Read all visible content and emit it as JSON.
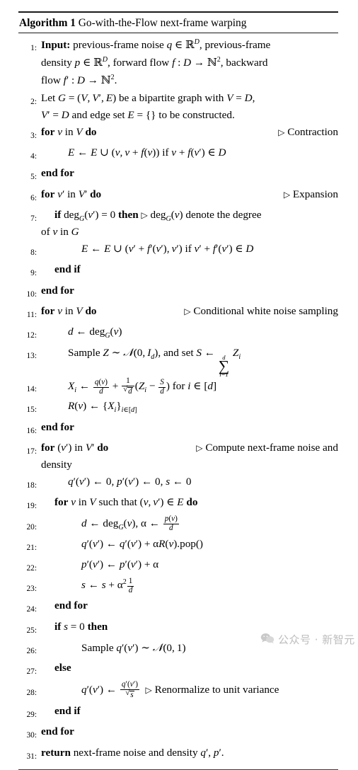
{
  "document": {
    "type": "algorithm-pseudocode-block",
    "title_keyword": "Algorithm 1",
    "title_text": "Go-with-the-Flow next-frame warping"
  },
  "lines": [
    {
      "no": "1:",
      "indent": 0,
      "text": "Input: previous-frame noise q ∈ ℝᴰ, previous-frame density p ∈ ℝᴰ, forward flow f : D → ℕ2, backward flow f′ : D → ℕ2.",
      "comment": ""
    },
    {
      "no": "2:",
      "indent": 0,
      "text": "Let G = (V, V′, E) be a bipartite graph with V = D, V′ = D and edge set E = {} to be constructed.",
      "comment": ""
    },
    {
      "no": "3:",
      "indent": 0,
      "text": "for v in V do",
      "comment": "Contraction"
    },
    {
      "no": "4:",
      "indent": 1,
      "text": "E ← E ∪ (v, v + f(v)) if v + f(v′) ∈ D",
      "comment": ""
    },
    {
      "no": "5:",
      "indent": 0,
      "text": "end for",
      "comment": ""
    },
    {
      "no": "6:",
      "indent": 0,
      "text": "for v′ in V′ do",
      "comment": "Expansion"
    },
    {
      "no": "7:",
      "indent": 1,
      "text": "if deg_G(v′) = 0 then",
      "comment": "deg_G(v) denote the degree of v in G"
    },
    {
      "no": "8:",
      "indent": 2,
      "text": "E ← E ∪ (v′ + f′(v′), v′) if v′ + f′(v′) ∈ D",
      "comment": ""
    },
    {
      "no": "9:",
      "indent": 1,
      "text": "end if",
      "comment": ""
    },
    {
      "no": "10:",
      "indent": 0,
      "text": "end for",
      "comment": ""
    },
    {
      "no": "11:",
      "indent": 0,
      "text": "for v in V do",
      "comment": "Conditional white noise sampling"
    },
    {
      "no": "12:",
      "indent": 1,
      "text": "d ← deg_G(v)",
      "comment": ""
    },
    {
      "no": "13:",
      "indent": 1,
      "text": "Sample Z ~ 𝒩(0, I_d), and set S ← ∑_{i=1}^{d} Z_i",
      "comment": ""
    },
    {
      "no": "14:",
      "indent": 1,
      "text": "X_i ← q(v)/d + 1/√d (Z_i − S/d) for i ∈ [d]",
      "comment": ""
    },
    {
      "no": "15:",
      "indent": 1,
      "text": "R(v) ← {X_i}_{i∈[d]}",
      "comment": ""
    },
    {
      "no": "16:",
      "indent": 0,
      "text": "end for",
      "comment": ""
    },
    {
      "no": "17:",
      "indent": 0,
      "text": "for (v′) in V′ do",
      "comment": "Compute next-frame noise and density"
    },
    {
      "no": "18:",
      "indent": 1,
      "text": "q′(v′) ← 0, p′(v′) ← 0, s ← 0",
      "comment": ""
    },
    {
      "no": "19:",
      "indent": 1,
      "text": "for v in V such that (v, v′) ∈ E do",
      "comment": ""
    },
    {
      "no": "20:",
      "indent": 2,
      "text": "d ← deg_G(v), α ← p(v)/d",
      "comment": ""
    },
    {
      "no": "21:",
      "indent": 2,
      "text": "q′(v′) ← q′(v′) + αR(v).pop()",
      "comment": ""
    },
    {
      "no": "22:",
      "indent": 2,
      "text": "p′(v′) ← p′(v′) + α",
      "comment": ""
    },
    {
      "no": "23:",
      "indent": 2,
      "text": "s ← s + α² 1/d",
      "comment": ""
    },
    {
      "no": "24:",
      "indent": 1,
      "text": "end for",
      "comment": ""
    },
    {
      "no": "25:",
      "indent": 1,
      "text": "if s = 0 then",
      "comment": ""
    },
    {
      "no": "26:",
      "indent": 2,
      "text": "Sample q′(v′) ~ 𝒩(0, 1)",
      "comment": ""
    },
    {
      "no": "27:",
      "indent": 1,
      "text": "else",
      "comment": ""
    },
    {
      "no": "28:",
      "indent": 2,
      "text": "q′(v′) ← q′(v′)/√s",
      "comment": "Renormalize to unit variance"
    },
    {
      "no": "29:",
      "indent": 1,
      "text": "end if",
      "comment": ""
    },
    {
      "no": "30:",
      "indent": 0,
      "text": "end for",
      "comment": ""
    },
    {
      "no": "31:",
      "indent": 0,
      "text": "return next-frame noise and density q′, p′.",
      "comment": ""
    }
  ],
  "line_numbers": {
    "n1": "1:",
    "n2": "2:",
    "n3": "3:",
    "n4": "4:",
    "n5": "5:",
    "n6": "6:",
    "n7": "7:",
    "n8": "8:",
    "n9": "9:",
    "n10": "10:",
    "n11": "11:",
    "n12": "12:",
    "n13": "13:",
    "n14": "14:",
    "n15": "15:",
    "n16": "16:",
    "n17": "17:",
    "n18": "18:",
    "n19": "19:",
    "n20": "20:",
    "n21": "21:",
    "n22": "22:",
    "n23": "23:",
    "n24": "24:",
    "n25": "25:",
    "n26": "26:",
    "n27": "27:",
    "n28": "28:",
    "n29": "29:",
    "n30": "30:",
    "n31": "31:"
  },
  "keywords": {
    "input": "Input:",
    "for": "for",
    "end_for": "end for",
    "if": "if",
    "then": "then",
    "else": "else",
    "end_if": "end if",
    "return": "return",
    "do": "do",
    "in": "in",
    "such_that": "such that"
  },
  "comments": {
    "contraction": "Contraction",
    "expansion": "Expansion",
    "deg_note_a": "denote the degree",
    "deg_note_b": "of",
    "deg_note_c": "in",
    "conditional": "Conditional white noise sampling",
    "compute_a": "Compute next-frame noise and",
    "compute_b": "density",
    "renormalize": "Renormalize to unit variance"
  },
  "text_fragments": {
    "l1_a": "previous-frame noise",
    "l1_b": ", previous-frame",
    "l1_c": "density",
    "l1_d": ", forward flow",
    "l1_e": ", backward",
    "l1_f": "flow",
    "l2_a": "Let",
    "l2_b": "be a bipartite graph with",
    "l2_c": "and edge set",
    "l2_d": "to be constructed.",
    "l4_if": "if",
    "l8_if": "if",
    "l13_sample": "Sample",
    "l13_andset": ", and set",
    "l14_for": "for",
    "l21_pop": ".pop()",
    "l26_sample": "Sample",
    "l31_a": "next-frame noise and density"
  },
  "watermark": {
    "text": "公众号 · 新智元",
    "color": "#bdbdbd",
    "icon": "wechat-icon"
  },
  "colors": {
    "page_background": "#ffffff",
    "text": "#000000",
    "rule": "#1a1a1a",
    "watermark": "#bdbdbd"
  }
}
